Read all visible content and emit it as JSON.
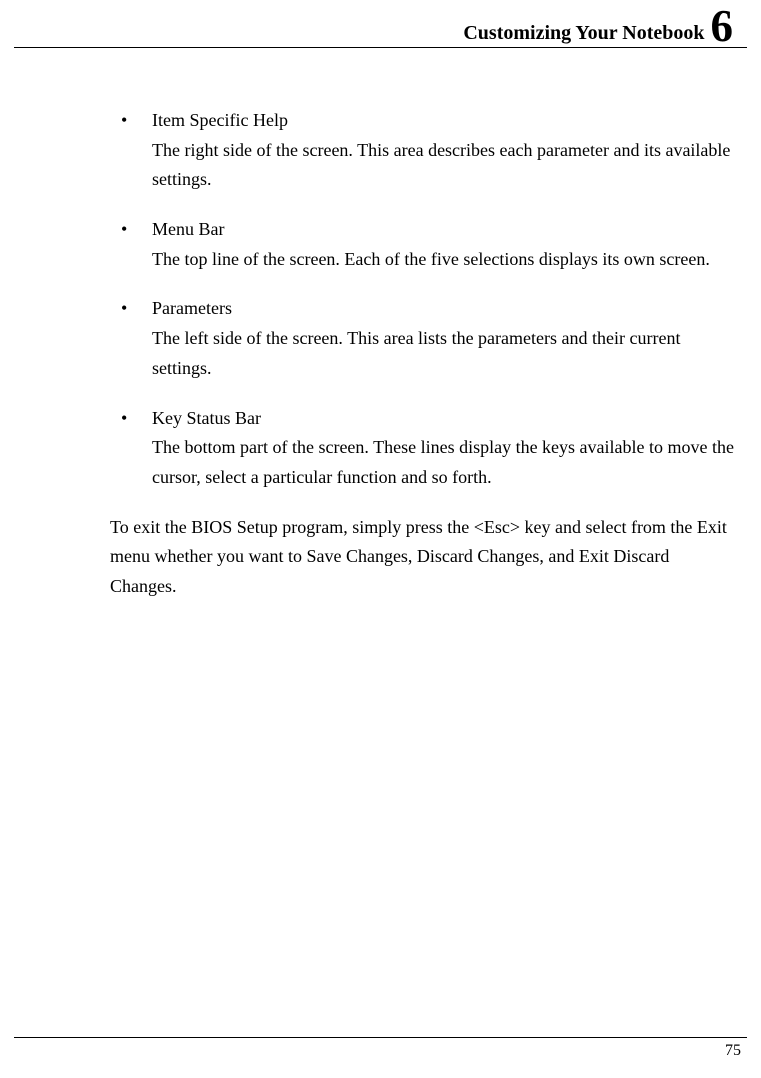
{
  "header": {
    "title": "Customizing Your Notebook",
    "chapter": "6"
  },
  "bullets": [
    {
      "title": "Item Specific Help",
      "desc": "The right side of the screen. This area describes each parameter and its available settings."
    },
    {
      "title": "Menu Bar",
      "desc": "The top line of the screen. Each of the five selections displays its own screen."
    },
    {
      "title": "Parameters",
      "desc": "The left side of the screen. This area lists the parameters and their current settings."
    },
    {
      "title": "Key Status Bar",
      "desc": "The bottom part of the screen. These lines display the keys available to move the cursor, select a particular function and so forth."
    }
  ],
  "paragraph": "To exit the BIOS Setup program, simply press the <Esc> key and select from the Exit menu whether you want to Save Changes, Discard Changes, and Exit Discard Changes.",
  "page_number": "75"
}
